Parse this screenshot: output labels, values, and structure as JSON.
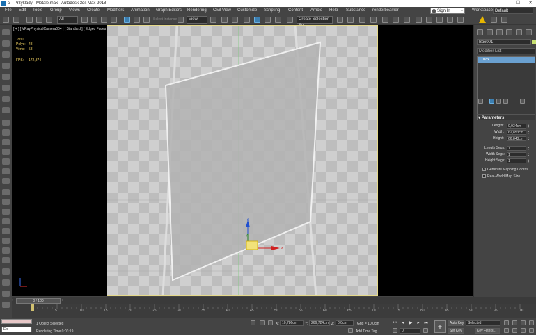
{
  "window": {
    "title": "3 - Przyklady - Metale.max - Autodesk 3ds Max 2018",
    "controls": [
      "—",
      "☐",
      "✕"
    ]
  },
  "menu": {
    "items": [
      "File",
      "Edit",
      "Tools",
      "Group",
      "Views",
      "Create",
      "Modifiers",
      "Animation",
      "Graph Editors",
      "Rendering",
      "Civil View",
      "Customize",
      "Scripting",
      "Content",
      "Arnold",
      "Help",
      "Substance",
      "renderbeamer"
    ],
    "sign_in": "Sign In",
    "workspaces_label": "Workspaces:",
    "workspaces_value": "Default"
  },
  "toolbar": {
    "filter_value": "All",
    "view_value": "View",
    "select_instance": "Select Instance",
    "named_selection": "Create Selection Se"
  },
  "viewport": {
    "label": "[ + ] [ VRayPhysicalCamera004 ] [ Standard ] [ Edged Faces ]",
    "stats": {
      "total_label": "Total",
      "polys_label": "Polys:",
      "polys_value": "48",
      "verts_label": "Verts:",
      "verts_value": "58",
      "fps_label": "FPS:",
      "fps_value": "172,374"
    },
    "gizmo": {
      "x": "x",
      "y": "y",
      "z": "z"
    }
  },
  "command_panel": {
    "object_name": "Box001",
    "modifier_list": "Modifier List",
    "stack_item": "Box",
    "rollout_title": "Parameters",
    "params": [
      {
        "label": "Length:",
        "value": "0,934cm"
      },
      {
        "label": "Width:",
        "value": "62,853cm"
      },
      {
        "label": "Height:",
        "value": "66,843cm"
      },
      {
        "label": "Length Segs:",
        "value": "1"
      },
      {
        "label": "Width Segs:",
        "value": "1"
      },
      {
        "label": "Height Segs:",
        "value": "1"
      }
    ],
    "generate_mapping": "Generate Mapping Coords.",
    "real_world": "Real-World Map Size"
  },
  "timeslider": {
    "frame_text": "0 / 100"
  },
  "trackbar": {
    "ticks": [
      "0",
      "5",
      "10",
      "15",
      "20",
      "25",
      "30",
      "35",
      "40",
      "45",
      "50",
      "55",
      "60",
      "65",
      "70",
      "75",
      "80",
      "85",
      "90",
      "95",
      "100"
    ]
  },
  "status": {
    "maxscript": "Exi",
    "selection": "1 Object Selected",
    "render_time": "Rendering Time  0:03:19",
    "x_label": "X:",
    "x_value": "10,786cm",
    "y_label": "Y:",
    "y_value": "266,724cm",
    "z_label": "Z:",
    "z_value": "0,0cm",
    "grid": "Grid = 10,0cm",
    "add_time_tag": "Add Time Tag",
    "auto_key": "Auto Key",
    "set_key": "Set Key",
    "selected": "Selected",
    "key_filters": "Key Filters...",
    "frame_value": "0"
  }
}
